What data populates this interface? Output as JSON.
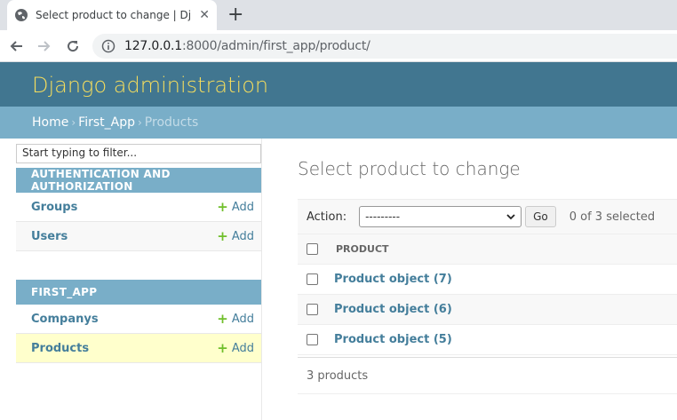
{
  "browser": {
    "tab_title": "Select product to change | Django site admin",
    "tab_close": "✕",
    "new_tab": "+",
    "url_host": "127.0.0.1",
    "url_rest": ":8000/admin/first_app/product/"
  },
  "header": {
    "brand": "Django administration"
  },
  "breadcrumbs": {
    "home": "Home",
    "app": "First_App",
    "current": "Products",
    "separator": "›"
  },
  "sidebar": {
    "filter_placeholder": "Start typing to filter...",
    "modules": [
      {
        "caption": "AUTHENTICATION AND AUTHORIZATION",
        "models": [
          {
            "name": "Groups",
            "add": "Add"
          },
          {
            "name": "Users",
            "add": "Add"
          }
        ]
      },
      {
        "caption": "FIRST_APP",
        "models": [
          {
            "name": "Companys",
            "add": "Add"
          },
          {
            "name": "Products",
            "add": "Add"
          }
        ]
      }
    ]
  },
  "content": {
    "title": "Select product to change",
    "action_label": "Action:",
    "action_value": "---------",
    "go_label": "Go",
    "selected_count": "0 of 3 selected",
    "column_header": "PRODUCT",
    "rows": [
      "Product object (7)",
      "Product object (6)",
      "Product object (5)"
    ],
    "paginator": "3 products"
  },
  "colors": {
    "header_bg": "#417690",
    "brand": "#f5dd5d",
    "breadcrumb_bg": "#79aec8",
    "link": "#447e9b",
    "add_plus": "#70bf2b",
    "current_row": "#ffffcc"
  }
}
